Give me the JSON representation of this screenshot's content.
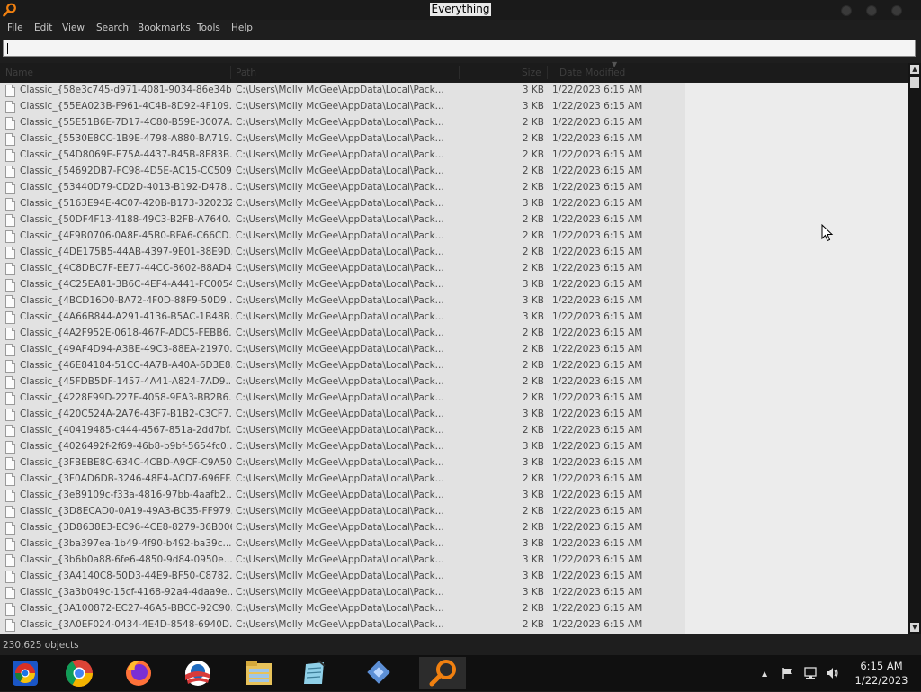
{
  "window": {
    "title": "Everything"
  },
  "menu": [
    "File",
    "Edit",
    "View",
    "Search",
    "Bookmarks",
    "Tools",
    "Help"
  ],
  "search": {
    "value": ""
  },
  "columns": [
    "Name",
    "Path",
    "Size",
    "Date Modified"
  ],
  "rows": [
    {
      "name": "Classic_{58e3c745-d971-4081-9034-86e34b...",
      "path": "C:\\Users\\Molly McGee\\AppData\\Local\\Pack...",
      "size": "3 KB",
      "date": "1/22/2023 6:15 AM"
    },
    {
      "name": "Classic_{55EA023B-F961-4C4B-8D92-4F109...",
      "path": "C:\\Users\\Molly McGee\\AppData\\Local\\Pack...",
      "size": "3 KB",
      "date": "1/22/2023 6:15 AM"
    },
    {
      "name": "Classic_{55E51B6E-7D17-4C80-B59E-3007A...",
      "path": "C:\\Users\\Molly McGee\\AppData\\Local\\Pack...",
      "size": "2 KB",
      "date": "1/22/2023 6:15 AM"
    },
    {
      "name": "Classic_{5530E8CC-1B9E-4798-A880-BA719...",
      "path": "C:\\Users\\Molly McGee\\AppData\\Local\\Pack...",
      "size": "2 KB",
      "date": "1/22/2023 6:15 AM"
    },
    {
      "name": "Classic_{54D8069E-E75A-4437-B45B-8E83B...",
      "path": "C:\\Users\\Molly McGee\\AppData\\Local\\Pack...",
      "size": "2 KB",
      "date": "1/22/2023 6:15 AM"
    },
    {
      "name": "Classic_{54692DB7-FC98-4D5E-AC15-CC509...",
      "path": "C:\\Users\\Molly McGee\\AppData\\Local\\Pack...",
      "size": "2 KB",
      "date": "1/22/2023 6:15 AM"
    },
    {
      "name": "Classic_{53440D79-CD2D-4013-B192-D478...",
      "path": "C:\\Users\\Molly McGee\\AppData\\Local\\Pack...",
      "size": "2 KB",
      "date": "1/22/2023 6:15 AM"
    },
    {
      "name": "Classic_{5163E94E-4C07-420B-B173-320232...",
      "path": "C:\\Users\\Molly McGee\\AppData\\Local\\Pack...",
      "size": "3 KB",
      "date": "1/22/2023 6:15 AM"
    },
    {
      "name": "Classic_{50DF4F13-4188-49C3-B2FB-A7640...",
      "path": "C:\\Users\\Molly McGee\\AppData\\Local\\Pack...",
      "size": "2 KB",
      "date": "1/22/2023 6:15 AM"
    },
    {
      "name": "Classic_{4F9B0706-0A8F-45B0-BFA6-C66CD...",
      "path": "C:\\Users\\Molly McGee\\AppData\\Local\\Pack...",
      "size": "2 KB",
      "date": "1/22/2023 6:15 AM"
    },
    {
      "name": "Classic_{4DE175B5-44AB-4397-9E01-38E9D...",
      "path": "C:\\Users\\Molly McGee\\AppData\\Local\\Pack...",
      "size": "2 KB",
      "date": "1/22/2023 6:15 AM"
    },
    {
      "name": "Classic_{4C8DBC7F-EE77-44CC-8602-88AD4...",
      "path": "C:\\Users\\Molly McGee\\AppData\\Local\\Pack...",
      "size": "2 KB",
      "date": "1/22/2023 6:15 AM"
    },
    {
      "name": "Classic_{4C25EA81-3B6C-4EF4-A441-FC0054...",
      "path": "C:\\Users\\Molly McGee\\AppData\\Local\\Pack...",
      "size": "3 KB",
      "date": "1/22/2023 6:15 AM"
    },
    {
      "name": "Classic_{4BCD16D0-BA72-4F0D-88F9-50D9...",
      "path": "C:\\Users\\Molly McGee\\AppData\\Local\\Pack...",
      "size": "3 KB",
      "date": "1/22/2023 6:15 AM"
    },
    {
      "name": "Classic_{4A66B844-A291-4136-B5AC-1B48B...",
      "path": "C:\\Users\\Molly McGee\\AppData\\Local\\Pack...",
      "size": "3 KB",
      "date": "1/22/2023 6:15 AM"
    },
    {
      "name": "Classic_{4A2F952E-0618-467F-ADC5-FEBB6...",
      "path": "C:\\Users\\Molly McGee\\AppData\\Local\\Pack...",
      "size": "2 KB",
      "date": "1/22/2023 6:15 AM"
    },
    {
      "name": "Classic_{49AF4D94-A3BE-49C3-88EA-21970...",
      "path": "C:\\Users\\Molly McGee\\AppData\\Local\\Pack...",
      "size": "2 KB",
      "date": "1/22/2023 6:15 AM"
    },
    {
      "name": "Classic_{46E84184-51CC-4A7B-A40A-6D3E8...",
      "path": "C:\\Users\\Molly McGee\\AppData\\Local\\Pack...",
      "size": "2 KB",
      "date": "1/22/2023 6:15 AM"
    },
    {
      "name": "Classic_{45FDB5DF-1457-4A41-A824-7AD9...",
      "path": "C:\\Users\\Molly McGee\\AppData\\Local\\Pack...",
      "size": "2 KB",
      "date": "1/22/2023 6:15 AM"
    },
    {
      "name": "Classic_{4228F99D-227F-4058-9EA3-BB2B6...",
      "path": "C:\\Users\\Molly McGee\\AppData\\Local\\Pack...",
      "size": "2 KB",
      "date": "1/22/2023 6:15 AM"
    },
    {
      "name": "Classic_{420C524A-2A76-43F7-B1B2-C3CF7...",
      "path": "C:\\Users\\Molly McGee\\AppData\\Local\\Pack...",
      "size": "3 KB",
      "date": "1/22/2023 6:15 AM"
    },
    {
      "name": "Classic_{40419485-c444-4567-851a-2dd7bf...",
      "path": "C:\\Users\\Molly McGee\\AppData\\Local\\Pack...",
      "size": "2 KB",
      "date": "1/22/2023 6:15 AM"
    },
    {
      "name": "Classic_{4026492f-2f69-46b8-b9bf-5654fc0...",
      "path": "C:\\Users\\Molly McGee\\AppData\\Local\\Pack...",
      "size": "3 KB",
      "date": "1/22/2023 6:15 AM"
    },
    {
      "name": "Classic_{3FBEBE8C-634C-4CBD-A9CF-C9A50...",
      "path": "C:\\Users\\Molly McGee\\AppData\\Local\\Pack...",
      "size": "3 KB",
      "date": "1/22/2023 6:15 AM"
    },
    {
      "name": "Classic_{3F0AD6DB-3246-48E4-ACD7-696FF...",
      "path": "C:\\Users\\Molly McGee\\AppData\\Local\\Pack...",
      "size": "2 KB",
      "date": "1/22/2023 6:15 AM"
    },
    {
      "name": "Classic_{3e89109c-f33a-4816-97bb-4aafb2...",
      "path": "C:\\Users\\Molly McGee\\AppData\\Local\\Pack...",
      "size": "3 KB",
      "date": "1/22/2023 6:15 AM"
    },
    {
      "name": "Classic_{3D8ECAD0-0A19-49A3-BC35-FF979...",
      "path": "C:\\Users\\Molly McGee\\AppData\\Local\\Pack...",
      "size": "2 KB",
      "date": "1/22/2023 6:15 AM"
    },
    {
      "name": "Classic_{3D8638E3-EC96-4CE8-8279-36B006...",
      "path": "C:\\Users\\Molly McGee\\AppData\\Local\\Pack...",
      "size": "2 KB",
      "date": "1/22/2023 6:15 AM"
    },
    {
      "name": "Classic_{3ba397ea-1b49-4f90-b492-ba39c...",
      "path": "C:\\Users\\Molly McGee\\AppData\\Local\\Pack...",
      "size": "3 KB",
      "date": "1/22/2023 6:15 AM"
    },
    {
      "name": "Classic_{3b6b0a88-6fe6-4850-9d84-0950e...",
      "path": "C:\\Users\\Molly McGee\\AppData\\Local\\Pack...",
      "size": "3 KB",
      "date": "1/22/2023 6:15 AM"
    },
    {
      "name": "Classic_{3A4140C8-50D3-44E9-BF50-C8782...",
      "path": "C:\\Users\\Molly McGee\\AppData\\Local\\Pack...",
      "size": "3 KB",
      "date": "1/22/2023 6:15 AM"
    },
    {
      "name": "Classic_{3a3b049c-15cf-4168-92a4-4daa9e...",
      "path": "C:\\Users\\Molly McGee\\AppData\\Local\\Pack...",
      "size": "3 KB",
      "date": "1/22/2023 6:15 AM"
    },
    {
      "name": "Classic_{3A100872-EC27-46A5-BBCC-92C90...",
      "path": "C:\\Users\\Molly McGee\\AppData\\Local\\Pack...",
      "size": "2 KB",
      "date": "1/22/2023 6:15 AM"
    },
    {
      "name": "Classic_{3A0EF024-0434-4E4D-8548-6940D...",
      "path": "C:\\Users\\Molly McGee\\AppData\\Local\\Pack...",
      "size": "2 KB",
      "date": "1/22/2023 6:15 AM"
    }
  ],
  "status": {
    "objects": "230,625 objects"
  },
  "taskbar": {
    "items": [
      "chrome-alt-icon",
      "chrome-icon",
      "firefox-icon",
      "obama-logo-icon",
      "file-explorer-icon",
      "notepad-icon",
      "app-icon",
      "everything-icon"
    ],
    "active": "everything-icon"
  },
  "tray": {
    "time": "6:15 AM",
    "date": "1/22/2023"
  },
  "colors": {
    "accent": "#f08010",
    "list_bg": "#ececec",
    "chrome_bg": "#1e1e1e"
  }
}
